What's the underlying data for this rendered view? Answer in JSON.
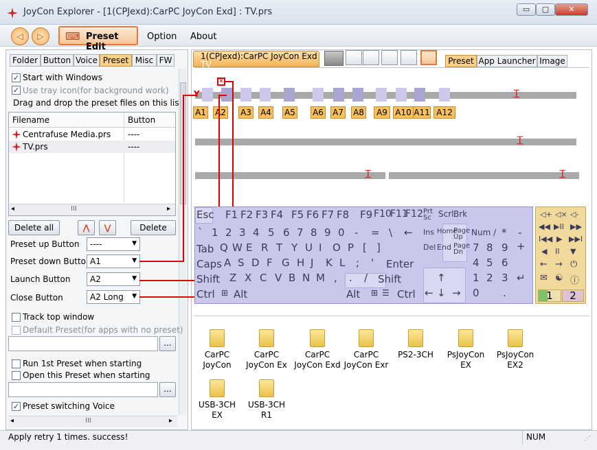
{
  "window": {
    "title": "JoyCon Explorer - [1(CPJexd):CarPC JoyCon Exd] : TV.prs",
    "min": "▭",
    "max": "▢",
    "close": "✕"
  },
  "menu": {
    "preset_edit": "Preset Edit",
    "option": "Option",
    "about": "About",
    "back": "◁",
    "forward": "▷"
  },
  "left_tabs": [
    "Folder",
    "Button",
    "Voice",
    "Preset",
    "Misc",
    "FW"
  ],
  "options": {
    "start_windows": "Start with Windows",
    "tray_icon": "Use tray icon(for background work)",
    "drag_drop": "Drag and drop the preset files on this list"
  },
  "file_list": {
    "col_filename": "Filename",
    "col_button": "Button",
    "rows": [
      {
        "name": "Centrafuse Media.prs",
        "button": "----"
      },
      {
        "name": "TV.prs",
        "button": "----"
      }
    ],
    "hscroll": "III"
  },
  "buttons": {
    "delete_all": "Delete all",
    "up": "⋀",
    "down": "⋁",
    "delete": "Delete"
  },
  "presets": {
    "up_label": "Preset up Button",
    "up_value": "----",
    "down_label": "Preset down Button",
    "down_value": "A1",
    "launch_label": "Launch Button",
    "launch_value": "A2",
    "close_label": "Close Button",
    "close_value": "A2 Long"
  },
  "more_options": {
    "track_top": "Track top window",
    "default_preset": "Default Preset(for apps with no preset)",
    "browse": "...",
    "run_1st": "Run 1st Preset when starting",
    "open_this": "Open this Preset when starting",
    "switch_voice": "Preset switching Voice"
  },
  "device_tab": "1(CPJexd):CarPC JoyCon Exd",
  "device_tab_sub": "TV",
  "right_tabs": [
    "Preset",
    "App Launcher",
    "Image"
  ],
  "button_labels": [
    "A1",
    "A2",
    "A3",
    "A4",
    "A5",
    "A6",
    "A7",
    "A8",
    "A9",
    "A10",
    "A11",
    "A12"
  ],
  "keyboard": {
    "row1": [
      "Esc",
      "F1",
      "F2",
      "F3",
      "F4",
      "F5",
      "F6",
      "F7",
      "F8",
      "F9",
      "F10",
      "F11",
      "F12"
    ],
    "prt": "Prt Sc",
    "scrl": "Scrl",
    "brk": "Brk",
    "row2": [
      "`",
      "1",
      "2",
      "3",
      "4",
      "5",
      "6",
      "7",
      "8",
      "9",
      "0",
      "-",
      "=",
      "\\",
      "←"
    ],
    "ins": "Ins",
    "home": "Home",
    "pageup": "Page Up",
    "num": "Num /",
    "ast": "*",
    "minus": "-",
    "row3": [
      "Tab",
      "Q",
      "W",
      "E",
      "R",
      "T",
      "Y",
      "U",
      "I",
      "O",
      "P",
      "[",
      "]"
    ],
    "del": "Del",
    "end": "End",
    "pagedn": "Page Dn",
    "n7": "7",
    "n8": "8",
    "n9": "9",
    "plus": "+",
    "row4": [
      "Caps",
      "A",
      "S",
      "D",
      "F",
      "G",
      "H",
      "J",
      "K",
      "L",
      ";",
      "'"
    ],
    "enter": "Enter",
    "n4": "4",
    "n5": "5",
    "n6": "6",
    "row5": [
      "Shift",
      "Z",
      "X",
      "C",
      "V",
      "B",
      "N",
      "M",
      ",",
      ".",
      "/"
    ],
    "shift_r": "Shift",
    "up": "↑",
    "n1": "1",
    "n2": "2",
    "n3": "3",
    "nenter": "↵",
    "row6": [
      "Ctrl",
      "⊞",
      "Alt"
    ],
    "alt_r": "Alt",
    "win_r": "⊞",
    "menu_r": "☰",
    "ctrl_r": "Ctrl",
    "left": "←",
    "down": "↓",
    "right": "→",
    "n0": "0",
    "ndot": "."
  },
  "media": [
    "◁+",
    "◁×",
    "◁-",
    "◀◀",
    "▶II",
    "▶▶",
    "I◀◀",
    "▶",
    "▶▶I",
    "◀",
    "II",
    "▼",
    "←",
    "→",
    "⏻",
    "✉",
    "☯",
    "ⓘ"
  ],
  "pages": {
    "p1": "1",
    "p2": "2"
  },
  "folders": [
    [
      "CarPC",
      "JoyCon"
    ],
    [
      "CarPC",
      "JoyCon Ex"
    ],
    [
      "CarPC",
      "JoyCon Exd"
    ],
    [
      "CarPC",
      "JoyCon Exr"
    ],
    [
      "PS2-3CH",
      ""
    ],
    [
      "PsJoyCon",
      "EX"
    ],
    [
      "PsJoyCon",
      "EX2"
    ],
    [
      "USB-3CH",
      "EX"
    ],
    [
      "USB-3CH",
      "R1"
    ]
  ],
  "status": {
    "message": "Apply retry  1 times. success!",
    "num": "NUM"
  }
}
